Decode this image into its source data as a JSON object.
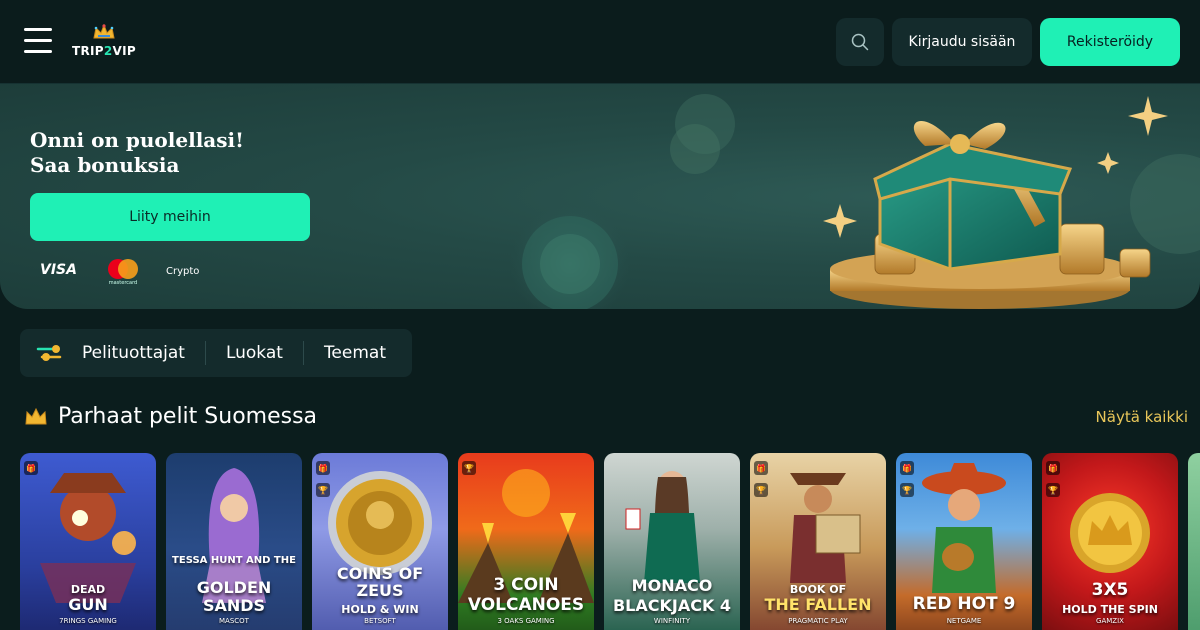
{
  "header": {
    "logo_word_a": "TRIP",
    "logo_word_b": "2",
    "logo_word_c": "VIP",
    "login_label": "Kirjaudu sisään",
    "register_label": "Rekisteröidy"
  },
  "hero": {
    "title_line1": "Onni on puolellasi!",
    "title_line2": "Saa bonuksia",
    "cta_label": "Liity meihin",
    "payments": {
      "visa": "VISA",
      "mastercard": "mastercard",
      "crypto": "Crypto"
    }
  },
  "tabs": [
    {
      "label": "Pelituottajat"
    },
    {
      "label": "Luokat"
    },
    {
      "label": "Teemat"
    }
  ],
  "section": {
    "title": "Parhaat pelit Suomessa",
    "view_all": "Näytä kaikki"
  },
  "games": [
    {
      "line1": "DEAD",
      "line2": "GUN",
      "provider": "7RINGS GAMING"
    },
    {
      "line1": "TESSA HUNT AND THE",
      "line2": "GOLDEN SANDS",
      "provider": "MASCOT"
    },
    {
      "line1": "COINS OF ZEUS",
      "line2": "HOLD & WIN",
      "provider": "BETSOFT"
    },
    {
      "line1": "3 COIN",
      "line2": "VOLCANOES",
      "provider": "3 OAKS GAMING"
    },
    {
      "line1": "MONACO",
      "line2": "BLACKJACK 4",
      "provider": "WINFINITY"
    },
    {
      "line1": "BOOK OF",
      "line2": "THE FALLEN",
      "provider": "PRAGMATIC PLAY"
    },
    {
      "line1": "",
      "line2": "RED HOT 9",
      "provider": "NETGAME"
    },
    {
      "line1": "3X5",
      "line2": "HOLD THE SPIN",
      "provider": "GAMZIX"
    }
  ],
  "colors": {
    "accent": "#1ff0b5",
    "background": "#0b1d1d",
    "panel": "#142b2c",
    "view_all": "#e8c65a"
  }
}
